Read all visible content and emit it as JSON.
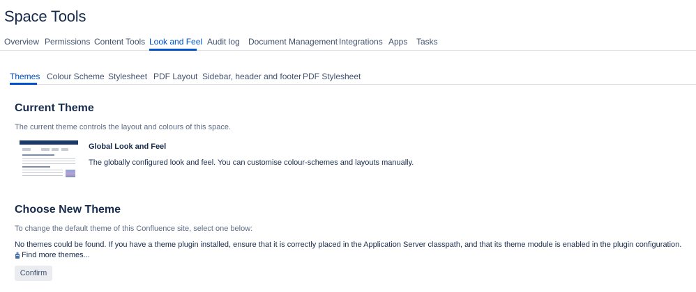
{
  "page": {
    "title": "Space Tools"
  },
  "top_nav": {
    "tabs": [
      {
        "label": "Overview"
      },
      {
        "label": "Permissions"
      },
      {
        "label": "Content Tools"
      },
      {
        "label": "Look and Feel",
        "active": true
      },
      {
        "label": "Audit log"
      },
      {
        "label": "Document Management"
      },
      {
        "label": "Integrations"
      },
      {
        "label": "Apps"
      },
      {
        "label": "Tasks"
      }
    ]
  },
  "sub_nav": {
    "tabs": [
      {
        "label": "Themes",
        "active": true
      },
      {
        "label": "Colour Scheme"
      },
      {
        "label": "Stylesheet"
      },
      {
        "label": "PDF Layout"
      },
      {
        "label": "Sidebar, header and footer"
      },
      {
        "label": "PDF Stylesheet"
      }
    ]
  },
  "current_theme": {
    "heading": "Current Theme",
    "description": "The current theme controls the layout and colours of this space.",
    "theme_name": "Global Look and Feel",
    "theme_description": "The globally configured look and feel. You can customise colour-schemes and layouts manually."
  },
  "choose_theme": {
    "heading": "Choose New Theme",
    "description": "To change the default theme of this Confluence site, select one below:",
    "no_themes_message": "No themes could be found. If you have a theme plugin installed, ensure that it is correctly placed in the Application Server classpath, and that its theme module is enabled in the plugin configuration.",
    "find_more_label": "Find more themes...",
    "find_more_icon": "plugin-icon",
    "confirm_label": "Confirm"
  },
  "colors": {
    "accent": "#0052cc",
    "text": "#172b4d",
    "subtle_text": "#5e6c84",
    "border": "#dfe1e6"
  }
}
